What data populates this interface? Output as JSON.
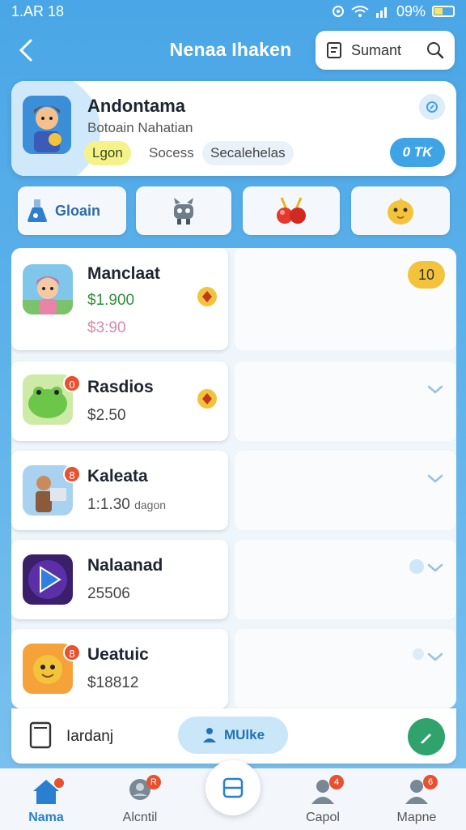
{
  "status_bar": {
    "time": "1.AR 18",
    "battery": "09%"
  },
  "header": {
    "title": "Nenaa Ihaken",
    "search_label": "Sumant"
  },
  "featured": {
    "name": "Andontama",
    "subtitle": "Botoain Nahatian",
    "chip_login": "Lgon",
    "chip_success": "Socess",
    "chip_sec": "Secalehelas",
    "pill": "0 TK"
  },
  "tiles": {
    "first_label": "Gloain"
  },
  "list": [
    {
      "title": "Manclaat",
      "value": "$1.900",
      "secondary": "$3:90",
      "badge": "10"
    },
    {
      "title": "Rasdios",
      "value": "$2.50",
      "icon_badge": "0"
    },
    {
      "title": "Kaleata",
      "value": "1:1.30",
      "value_suffix": "dagon",
      "icon_badge": "8"
    },
    {
      "title": "Nalaanad",
      "value": "25506"
    },
    {
      "title": "Ueatuic",
      "value": "$18812",
      "icon_badge": "8"
    }
  ],
  "action_bar": {
    "label": "Iardanj",
    "button": "MUlke"
  },
  "nav": {
    "home": "Nama",
    "item2": "Alcntil",
    "item4": "Capol",
    "item5": "Mapne",
    "item2_badge": "R",
    "item4_badge": "4",
    "item5_badge": "6"
  },
  "colors": {
    "accent": "#3ea4e6",
    "badge": "#e8512f",
    "fab": "#2fa36b",
    "value_green": "#2f8f3a",
    "value_pink": "#d98aa6"
  }
}
